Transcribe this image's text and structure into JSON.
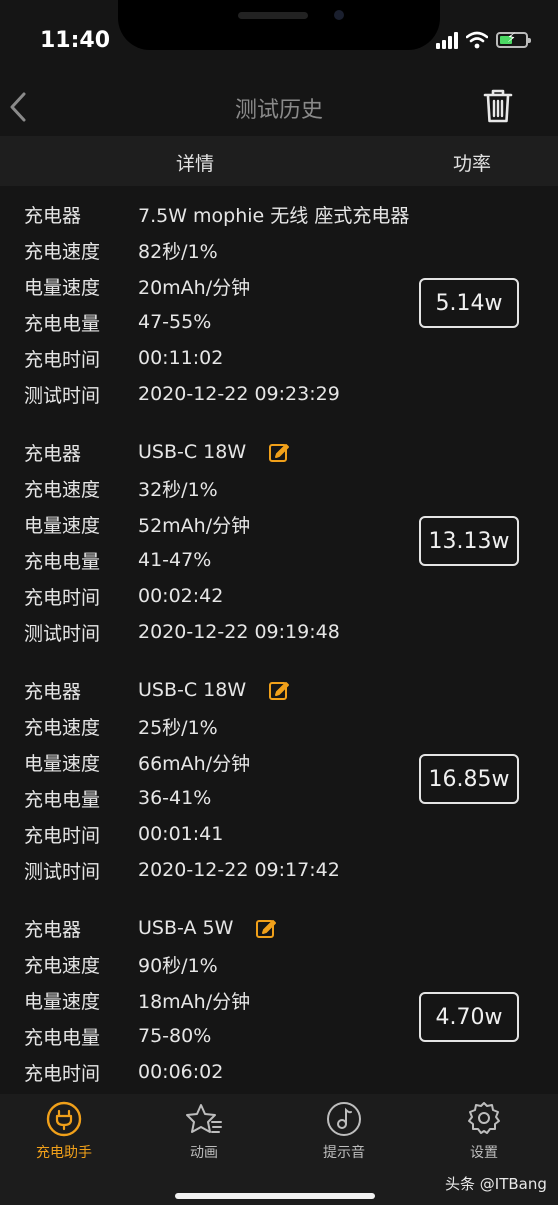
{
  "status": {
    "time": "11:40"
  },
  "nav": {
    "title": "测试历史",
    "back_icon": "chevron-left-icon",
    "delete_icon": "trash-icon"
  },
  "columns": {
    "detail": "详情",
    "power": "功率"
  },
  "labels": {
    "charger": "充电器",
    "speed": "充电速度",
    "rate": "电量速度",
    "amount": "充电电量",
    "duration": "充电时间",
    "test_time": "测试时间"
  },
  "records": [
    {
      "charger": "7.5W mophie 无线 座式充电器",
      "editable": false,
      "speed": "82秒/1%",
      "rate": "20mAh/分钟",
      "amount": "47-55%",
      "duration": "00:11:02",
      "test_time": "2020-12-22 09:23:29",
      "power": "5.14w"
    },
    {
      "charger": "USB-C 18W",
      "editable": true,
      "speed": "32秒/1%",
      "rate": "52mAh/分钟",
      "amount": "41-47%",
      "duration": "00:02:42",
      "test_time": "2020-12-22 09:19:48",
      "power": "13.13w"
    },
    {
      "charger": "USB-C 18W",
      "editable": true,
      "speed": "25秒/1%",
      "rate": "66mAh/分钟",
      "amount": "36-41%",
      "duration": "00:01:41",
      "test_time": "2020-12-22 09:17:42",
      "power": "16.85w"
    },
    {
      "charger": "USB-A 5W",
      "editable": true,
      "speed": "90秒/1%",
      "rate": "18mAh/分钟",
      "amount": "75-80%",
      "duration": "00:06:02",
      "test_time": "",
      "power": "4.70w"
    }
  ],
  "tabbar": {
    "active_color": "#f0a01a",
    "items": [
      {
        "label": "充电助手",
        "icon": "plug-icon"
      },
      {
        "label": "动画",
        "icon": "star-icon"
      },
      {
        "label": "提示音",
        "icon": "music-note-icon"
      },
      {
        "label": "设置",
        "icon": "gear-icon"
      }
    ]
  },
  "watermark": "头条 @ITBang"
}
